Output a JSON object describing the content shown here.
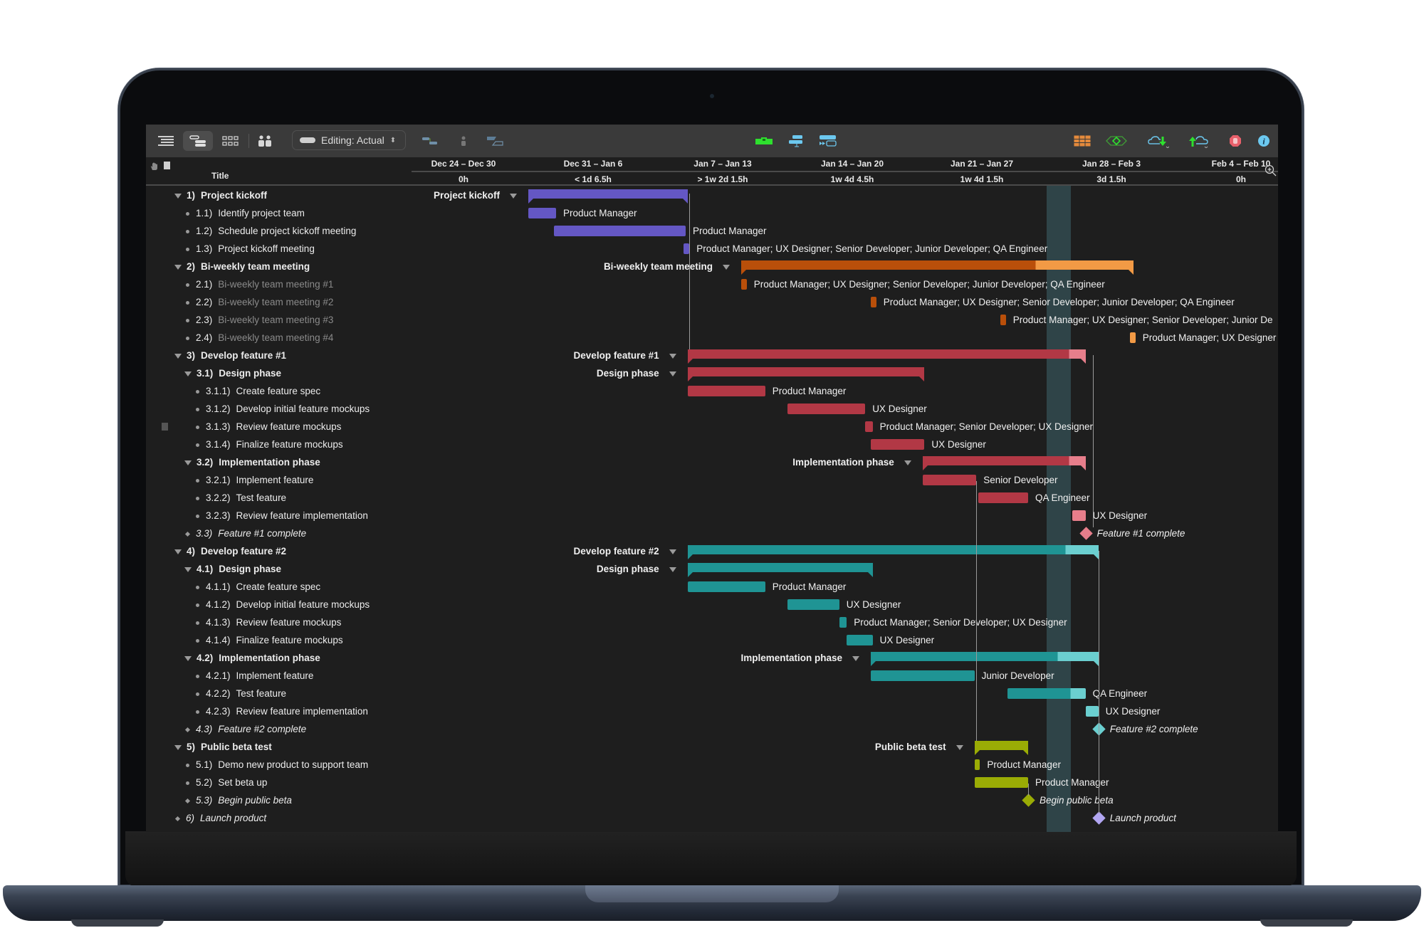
{
  "toolbar": {
    "editing_label": "Editing: Actual",
    "left_icons": [
      "outline-view-icon",
      "gantt-view-icon",
      "network-view-icon",
      "resources-view-icon"
    ],
    "mid_icons": [
      "connect-tasks-icon",
      "assign-resource-icon",
      "split-task-icon"
    ],
    "center_icons": [
      "level-resources-icon",
      "catch-up-icon",
      "reschedule-icon"
    ],
    "right_icons": [
      "table-icon",
      "milestone-view-icon",
      "cloud-download-icon",
      "cloud-upload-icon",
      "stop-icon",
      "info-icon"
    ],
    "colors": {
      "green": "#2ee02e",
      "blue": "#6cc8ef",
      "orange": "#e48a3c",
      "red": "#e8606b"
    }
  },
  "header": {
    "title_column": "Title",
    "weeks": [
      {
        "label": "Dec 24 – Dec 30",
        "hours": "0h"
      },
      {
        "label": "Dec 31 – Jan 6",
        "hours": "< 1d 6.5h"
      },
      {
        "label": "Jan 7 – Jan 13",
        "hours": "> 1w 2d 1.5h"
      },
      {
        "label": "Jan 14 – Jan 20",
        "hours": "1w 4d 4.5h"
      },
      {
        "label": "Jan 21 – Jan 27",
        "hours": "1w 4d 1.5h"
      },
      {
        "label": "Jan 28 – Feb 3",
        "hours": "3d 1.5h"
      },
      {
        "label": "Feb 4 – Feb 10",
        "hours": "0h"
      }
    ]
  },
  "timeline": {
    "origin": "Dec 24",
    "today_start_day": 35.0,
    "today_end_day": 36.3
  },
  "colors": {
    "kickoff": "#6457c4",
    "meeting": "#b94f0a",
    "meeting_light": "#f29a45",
    "feature1": "#b23845",
    "feature1_light": "#e77e8b",
    "feature2": "#1f9494",
    "feature2_light": "#6bcfd0",
    "beta": "#9aac05",
    "launch": "#b2a6f2"
  },
  "rows": [
    {
      "num": "1)",
      "title": "Project kickoff",
      "level": 0,
      "kind": "group",
      "style": "bold",
      "color": "kickoff",
      "start": 7.0,
      "end": 15.6,
      "gantt_label": "Project kickoff"
    },
    {
      "num": "1.1)",
      "title": "Identify project team",
      "level": 1,
      "kind": "task",
      "color": "kickoff",
      "start": 7.0,
      "end": 8.5,
      "resources": "Product Manager"
    },
    {
      "num": "1.2)",
      "title": "Schedule project kickoff meeting",
      "level": 1,
      "kind": "task",
      "color": "kickoff",
      "start": 8.4,
      "end": 15.5,
      "resources": "Product Manager"
    },
    {
      "num": "1.3)",
      "title": "Project kickoff meeting",
      "level": 1,
      "kind": "task",
      "color": "kickoff",
      "start": 15.4,
      "end": 15.7,
      "resources": "Product Manager; UX Designer; Senior Developer; Junior Developer; QA Engineer"
    },
    {
      "num": "2)",
      "title": "Bi-weekly team meeting",
      "level": 0,
      "kind": "group",
      "style": "bold",
      "color": "meeting",
      "start": 18.5,
      "end": 39.7,
      "done_until": 34.4,
      "gantt_label": "Bi-weekly team meeting"
    },
    {
      "num": "2.1)",
      "title": "Bi-weekly team meeting #1",
      "level": 1,
      "kind": "task",
      "style": "dim",
      "color": "meeting",
      "start": 18.5,
      "end": 18.8,
      "resources": "Product Manager; UX Designer; Senior Developer; Junior Developer; QA Engineer"
    },
    {
      "num": "2.2)",
      "title": "Bi-weekly team meeting #2",
      "level": 1,
      "kind": "task",
      "style": "dim",
      "color": "meeting",
      "start": 25.5,
      "end": 25.8,
      "resources": "Product Manager; UX Designer; Senior Developer; Junior Developer; QA Engineer"
    },
    {
      "num": "2.3)",
      "title": "Bi-weekly team meeting #3",
      "level": 1,
      "kind": "task",
      "style": "dim",
      "color": "meeting",
      "start": 32.5,
      "end": 32.8,
      "resources": "Product Manager; UX Designer; Senior Developer; Junior De"
    },
    {
      "num": "2.4)",
      "title": "Bi-weekly team meeting #4",
      "level": 1,
      "kind": "task",
      "style": "dim",
      "color": "meeting_light",
      "start": 39.5,
      "end": 39.8,
      "resources": "Product Manager; UX Designer"
    },
    {
      "num": "3)",
      "title": "Develop feature #1",
      "level": 0,
      "kind": "group",
      "style": "bold",
      "color": "feature1",
      "start": 15.6,
      "end": 37.1,
      "done_until": 36.2,
      "gantt_label": "Develop feature #1"
    },
    {
      "num": "3.1)",
      "title": "Design phase",
      "level": 1,
      "kind": "group",
      "style": "bold",
      "color": "feature1",
      "start": 15.6,
      "end": 28.4,
      "gantt_label": "Design phase"
    },
    {
      "num": "3.1.1)",
      "title": "Create feature spec",
      "level": 2,
      "kind": "task",
      "color": "feature1",
      "start": 15.6,
      "end": 19.8,
      "resources": "Product Manager"
    },
    {
      "num": "3.1.2)",
      "title": "Develop initial feature mockups",
      "level": 2,
      "kind": "task",
      "color": "feature1",
      "start": 21.0,
      "end": 25.2,
      "resources": "UX Designer"
    },
    {
      "num": "3.1.3)",
      "title": "Review feature mockups",
      "level": 2,
      "kind": "task",
      "color": "feature1",
      "start": 25.2,
      "end": 25.6,
      "resources": "Product Manager; Senior Developer; UX Designer",
      "has_note": true
    },
    {
      "num": "3.1.4)",
      "title": "Finalize feature mockups",
      "level": 2,
      "kind": "task",
      "color": "feature1",
      "start": 25.5,
      "end": 28.4,
      "resources": "UX Designer"
    },
    {
      "num": "3.2)",
      "title": "Implementation phase",
      "level": 1,
      "kind": "group",
      "style": "bold",
      "color": "feature1",
      "start": 28.3,
      "end": 37.1,
      "done_until": 36.2,
      "gantt_label": "Implementation phase"
    },
    {
      "num": "3.2.1)",
      "title": "Implement feature",
      "level": 2,
      "kind": "task",
      "color": "feature1",
      "start": 28.3,
      "end": 31.2,
      "resources": "Senior Developer"
    },
    {
      "num": "3.2.2)",
      "title": "Test feature",
      "level": 2,
      "kind": "task",
      "color": "feature1",
      "start": 31.3,
      "end": 34.0,
      "resources": "QA Engineer"
    },
    {
      "num": "3.2.3)",
      "title": "Review feature implementation",
      "level": 2,
      "kind": "task",
      "color": "feature1_light",
      "start": 36.4,
      "end": 37.1,
      "resources": "UX Designer"
    },
    {
      "num": "3.3)",
      "title": "Feature #1 complete",
      "level": 1,
      "kind": "milestone",
      "style": "ital",
      "color": "feature1_light",
      "start": 37.1,
      "resources": "Feature #1 complete"
    },
    {
      "num": "4)",
      "title": "Develop feature #2",
      "level": 0,
      "kind": "group",
      "style": "bold",
      "color": "feature2",
      "start": 15.6,
      "end": 37.8,
      "done_until": 36.0,
      "gantt_label": "Develop feature #2"
    },
    {
      "num": "4.1)",
      "title": "Design phase",
      "level": 1,
      "kind": "group",
      "style": "bold",
      "color": "feature2",
      "start": 15.6,
      "end": 25.6,
      "gantt_label": "Design phase"
    },
    {
      "num": "4.1.1)",
      "title": "Create feature spec",
      "level": 2,
      "kind": "task",
      "color": "feature2",
      "start": 15.6,
      "end": 19.8,
      "resources": "Product Manager"
    },
    {
      "num": "4.1.2)",
      "title": "Develop initial feature mockups",
      "level": 2,
      "kind": "task",
      "color": "feature2",
      "start": 21.0,
      "end": 23.8,
      "resources": "UX Designer"
    },
    {
      "num": "4.1.3)",
      "title": "Review feature mockups",
      "level": 2,
      "kind": "task",
      "color": "feature2",
      "start": 23.8,
      "end": 24.2,
      "resources": "Product Manager; Senior Developer; UX Designer"
    },
    {
      "num": "4.1.4)",
      "title": "Finalize feature mockups",
      "level": 2,
      "kind": "task",
      "color": "feature2",
      "start": 24.2,
      "end": 25.6,
      "resources": "UX Designer"
    },
    {
      "num": "4.2)",
      "title": "Implementation phase",
      "level": 1,
      "kind": "group",
      "style": "bold",
      "color": "feature2",
      "start": 25.5,
      "end": 37.8,
      "done_until": 35.6,
      "gantt_label": "Implementation phase"
    },
    {
      "num": "4.2.1)",
      "title": "Implement feature",
      "level": 2,
      "kind": "task",
      "color": "feature2",
      "start": 25.5,
      "end": 31.1,
      "resources": "Junior Developer"
    },
    {
      "num": "4.2.2)",
      "title": "Test feature",
      "level": 2,
      "kind": "task",
      "color": "feature2",
      "start": 32.9,
      "end": 37.1,
      "done_until": 36.3,
      "resources": "QA Engineer"
    },
    {
      "num": "4.2.3)",
      "title": "Review feature implementation",
      "level": 2,
      "kind": "task",
      "color": "feature2_light",
      "start": 37.1,
      "end": 37.8,
      "resources": "UX Designer"
    },
    {
      "num": "4.3)",
      "title": "Feature #2 complete",
      "level": 1,
      "kind": "milestone",
      "style": "ital",
      "color": "feature2_light",
      "start": 37.8,
      "resources": "Feature #2 complete"
    },
    {
      "num": "5)",
      "title": "Public beta test",
      "level": 0,
      "kind": "group",
      "style": "bold",
      "color": "beta",
      "start": 31.1,
      "end": 34.0,
      "gantt_label": "Public beta test"
    },
    {
      "num": "5.1)",
      "title": "Demo new product to support team",
      "level": 1,
      "kind": "task",
      "color": "beta",
      "start": 31.1,
      "end": 31.4,
      "resources": "Product Manager"
    },
    {
      "num": "5.2)",
      "title": "Set beta up",
      "level": 1,
      "kind": "task",
      "color": "beta",
      "start": 31.1,
      "end": 34.0,
      "resources": "Product Manager"
    },
    {
      "num": "5.3)",
      "title": "Begin public beta",
      "level": 1,
      "kind": "milestone",
      "style": "ital",
      "color": "beta",
      "start": 34.0,
      "resources": "Begin public beta"
    },
    {
      "num": "6)",
      "title": "Launch product",
      "level": 0,
      "kind": "milestone",
      "style": "ital",
      "color": "launch",
      "start": 37.8,
      "resources": "Launch product"
    }
  ]
}
